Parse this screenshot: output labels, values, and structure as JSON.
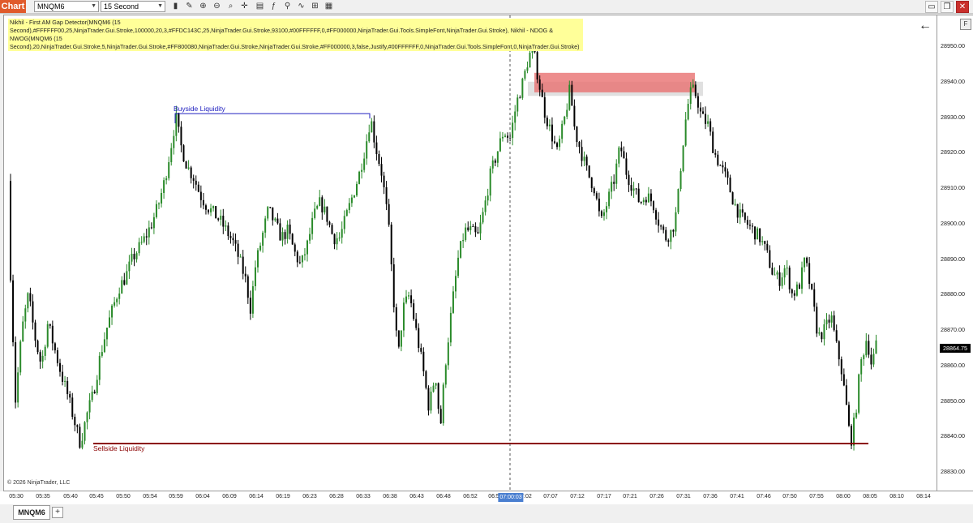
{
  "titlebar": {
    "chart_tab": "Chart",
    "instrument": "MNQM6",
    "interval": "15 Second"
  },
  "toolbar_icons": [
    "bar-chart-icon",
    "pencil-icon",
    "zoom-in-icon",
    "zoom-out-icon",
    "magnifier-icon",
    "crosshair-icon",
    "strategy-icon",
    "indicators-icon",
    "properties-icon",
    "templates-icon",
    "snapshot-icon",
    "data-box-icon"
  ],
  "indicator_label": "Nikhil - First AM Gap Detector(MNQM6 (15 Second),#FFFFFF00,25,NinjaTrader.Gui.Stroke,100000,20,3,#FFDC143C,25,NinjaTrader.Gui.Stroke,93100,#00FFFFFF,0,#FF000000,NinjaTrader.Gui.Tools.SimpleFont,NinjaTrader.Gui.Stroke), Nikhil - NDOG & NWOG(MNQM6 (15 Second),20,NinjaTrader.Gui.Stroke,5,NinjaTrader.Gui.Stroke,#FF800080,NinjaTrader.Gui.Stroke,NinjaTrader.Gui.Stroke,#FF000000,3,false,Justify,#00FFFFFF,0,NinjaTrader.Gui.Tools.SimpleFont,0,NinjaTrader.Gui.Stroke)",
  "copyright": "© 2026 NinjaTrader, LLC",
  "annotations": {
    "buyside": "Buyside Liquidity",
    "sellside": "Sellside Liquidity"
  },
  "y_axis": {
    "ticks": [
      "28950.00",
      "28940.00",
      "28930.00",
      "28920.00",
      "28910.00",
      "28900.00",
      "28890.00",
      "28880.00",
      "28870.00",
      "28860.00",
      "28850.00",
      "28840.00",
      "28830.00"
    ],
    "last_price": "28864.75",
    "format_button": "F"
  },
  "x_axis": {
    "ticks": [
      "05:30",
      "05:35",
      "05:40",
      "05:45",
      "05:50",
      "05:54",
      "05:59",
      "06:04",
      "06:09",
      "06:14",
      "06:19",
      "06:23",
      "06:28",
      "06:33",
      "06:38",
      "06:43",
      "06:48",
      "06:52",
      "06:5",
      "07:02",
      "07:07",
      "07:12",
      "07:17",
      "07:21",
      "07:26",
      "07:31",
      "07:36",
      "07:41",
      "07:46",
      "07:50",
      "07:55",
      "08:00",
      "08:05",
      "08:10",
      "08:14"
    ],
    "crosshair_time": "07:00:03"
  },
  "bottom_tabs": {
    "active": "MNQM6",
    "add": "+"
  },
  "chart_data": {
    "type": "candlestick",
    "instrument": "MNQM6",
    "interval": "15 Second",
    "ylim": [
      28826,
      28955
    ],
    "colors": {
      "up": "#2a8a2a",
      "down": "#000000",
      "gap_box": "#e87070",
      "buyside": "#2020c0",
      "sellside": "#8b0000"
    },
    "price_path": [
      [
        0,
        28912
      ],
      [
        6,
        28898
      ],
      [
        14,
        28850
      ],
      [
        22,
        28870
      ],
      [
        30,
        28880
      ],
      [
        38,
        28868
      ],
      [
        46,
        28860
      ],
      [
        54,
        28872
      ],
      [
        62,
        28865
      ],
      [
        70,
        28858
      ],
      [
        78,
        28852
      ],
      [
        86,
        28845
      ],
      [
        94,
        28838
      ],
      [
        102,
        28846
      ],
      [
        110,
        28852
      ],
      [
        118,
        28862
      ],
      [
        126,
        28870
      ],
      [
        134,
        28876
      ],
      [
        142,
        28882
      ],
      [
        150,
        28885
      ],
      [
        158,
        28890
      ],
      [
        166,
        28893
      ],
      [
        174,
        28896
      ],
      [
        182,
        28900
      ],
      [
        190,
        28905
      ],
      [
        198,
        28912
      ],
      [
        206,
        28922
      ],
      [
        212,
        28930
      ],
      [
        218,
        28922
      ],
      [
        226,
        28916
      ],
      [
        234,
        28913
      ],
      [
        242,
        28908
      ],
      [
        250,
        28905
      ],
      [
        258,
        28903
      ],
      [
        266,
        28901
      ],
      [
        274,
        28898
      ],
      [
        282,
        28895
      ],
      [
        290,
        28890
      ],
      [
        298,
        28884
      ],
      [
        304,
        28876
      ],
      [
        310,
        28888
      ],
      [
        318,
        28896
      ],
      [
        326,
        28904
      ],
      [
        334,
        28900
      ],
      [
        342,
        28896
      ],
      [
        350,
        28898
      ],
      [
        358,
        28892
      ],
      [
        366,
        28888
      ],
      [
        374,
        28894
      ],
      [
        382,
        28902
      ],
      [
        390,
        28906
      ],
      [
        398,
        28902
      ],
      [
        406,
        28896
      ],
      [
        414,
        28896
      ],
      [
        422,
        28902
      ],
      [
        430,
        28908
      ],
      [
        438,
        28914
      ],
      [
        446,
        28922
      ],
      [
        452,
        28930
      ],
      [
        458,
        28922
      ],
      [
        466,
        28914
      ],
      [
        474,
        28900
      ],
      [
        480,
        28880
      ],
      [
        486,
        28862
      ],
      [
        492,
        28876
      ],
      [
        500,
        28880
      ],
      [
        508,
        28870
      ],
      [
        516,
        28860
      ],
      [
        524,
        28848
      ],
      [
        532,
        28858
      ],
      [
        538,
        28842
      ],
      [
        544,
        28860
      ],
      [
        552,
        28876
      ],
      [
        560,
        28890
      ],
      [
        568,
        28898
      ],
      [
        576,
        28898
      ],
      [
        584,
        28896
      ],
      [
        592,
        28904
      ],
      [
        600,
        28914
      ],
      [
        608,
        28920
      ],
      [
        616,
        28926
      ],
      [
        624,
        28924
      ],
      [
        632,
        28934
      ],
      [
        640,
        28940
      ],
      [
        646,
        28946
      ],
      [
        652,
        28950
      ],
      [
        658,
        28942
      ],
      [
        666,
        28932
      ],
      [
        674,
        28926
      ],
      [
        682,
        28920
      ],
      [
        690,
        28928
      ],
      [
        698,
        28938
      ],
      [
        704,
        28926
      ],
      [
        712,
        28920
      ],
      [
        720,
        28914
      ],
      [
        728,
        28910
      ],
      [
        736,
        28900
      ],
      [
        744,
        28906
      ],
      [
        752,
        28912
      ],
      [
        760,
        28922
      ],
      [
        768,
        28914
      ],
      [
        776,
        28910
      ],
      [
        784,
        28906
      ],
      [
        792,
        28908
      ],
      [
        800,
        28906
      ],
      [
        808,
        28900
      ],
      [
        816,
        28896
      ],
      [
        824,
        28898
      ],
      [
        830,
        28904
      ],
      [
        836,
        28920
      ],
      [
        842,
        28932
      ],
      [
        848,
        28938
      ],
      [
        854,
        28936
      ],
      [
        860,
        28930
      ],
      [
        868,
        28928
      ],
      [
        876,
        28920
      ],
      [
        884,
        28916
      ],
      [
        892,
        28912
      ],
      [
        900,
        28906
      ],
      [
        908,
        28902
      ],
      [
        916,
        28900
      ],
      [
        924,
        28898
      ],
      [
        932,
        28896
      ],
      [
        940,
        28892
      ],
      [
        948,
        28886
      ],
      [
        956,
        28884
      ],
      [
        964,
        28888
      ],
      [
        972,
        28880
      ],
      [
        980,
        28882
      ],
      [
        988,
        28890
      ],
      [
        996,
        28880
      ],
      [
        1004,
        28868
      ],
      [
        1012,
        28870
      ],
      [
        1020,
        28874
      ],
      [
        1026,
        28866
      ],
      [
        1032,
        28860
      ],
      [
        1038,
        28850
      ],
      [
        1044,
        28838
      ],
      [
        1050,
        28846
      ],
      [
        1056,
        28860
      ],
      [
        1064,
        28868
      ],
      [
        1070,
        28860
      ],
      [
        1078,
        28868
      ]
    ],
    "gap_box": {
      "x_start_time": "07:04",
      "x_end_time": "07:34",
      "top": 28942.5,
      "bottom": 28937
    },
    "gap_box_shadow": {
      "top": 28940,
      "bottom": 28936
    },
    "buyside_liquidity": {
      "price": 28931,
      "label": "Buyside Liquidity"
    },
    "sellside_liquidity": {
      "price": 28838,
      "label": "Sellside Liquidity"
    },
    "crosshair_time": "07:00:03"
  }
}
